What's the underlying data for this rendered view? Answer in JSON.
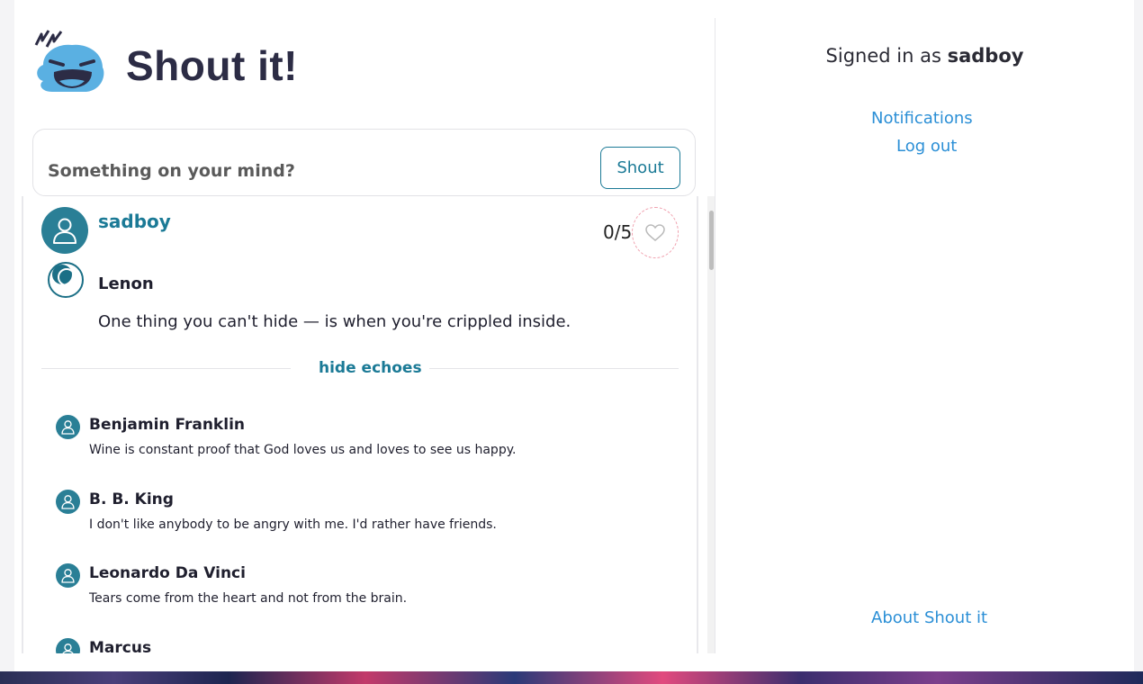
{
  "app": {
    "title": "Shout it!"
  },
  "composer": {
    "placeholder": "Something on your mind?",
    "submit_label": "Shout"
  },
  "post": {
    "author": "sadboy",
    "likes": "0/5",
    "quote_author": "Lenon",
    "quote_text": "One thing you can't hide — is when you're crippled inside.",
    "echoes_toggle": "hide echoes"
  },
  "echoes": [
    {
      "name": "Benjamin Franklin",
      "text": "Wine is constant proof that God loves us and loves to see us happy."
    },
    {
      "name": "B. B. King",
      "text": "I don't like anybody to be angry with me. I'd rather have friends."
    },
    {
      "name": "Leonardo Da Vinci",
      "text": "Tears come from the heart and not from the brain."
    },
    {
      "name": "Marcus",
      "text": ""
    }
  ],
  "sidebar": {
    "signed_in_prefix": "Signed in as",
    "username": "sadboy",
    "notifications": "Notifications",
    "logout": "Log out",
    "about": "About Shout it"
  },
  "colors": {
    "accent": "#1b7a96",
    "link": "#2b8fd6",
    "avatar": "#2a7f96",
    "title": "#2c2c45"
  },
  "icons": {
    "logo": "shouting-face-icon",
    "user": "user-icon",
    "heart": "heart-icon",
    "moon": "moon-icon"
  }
}
